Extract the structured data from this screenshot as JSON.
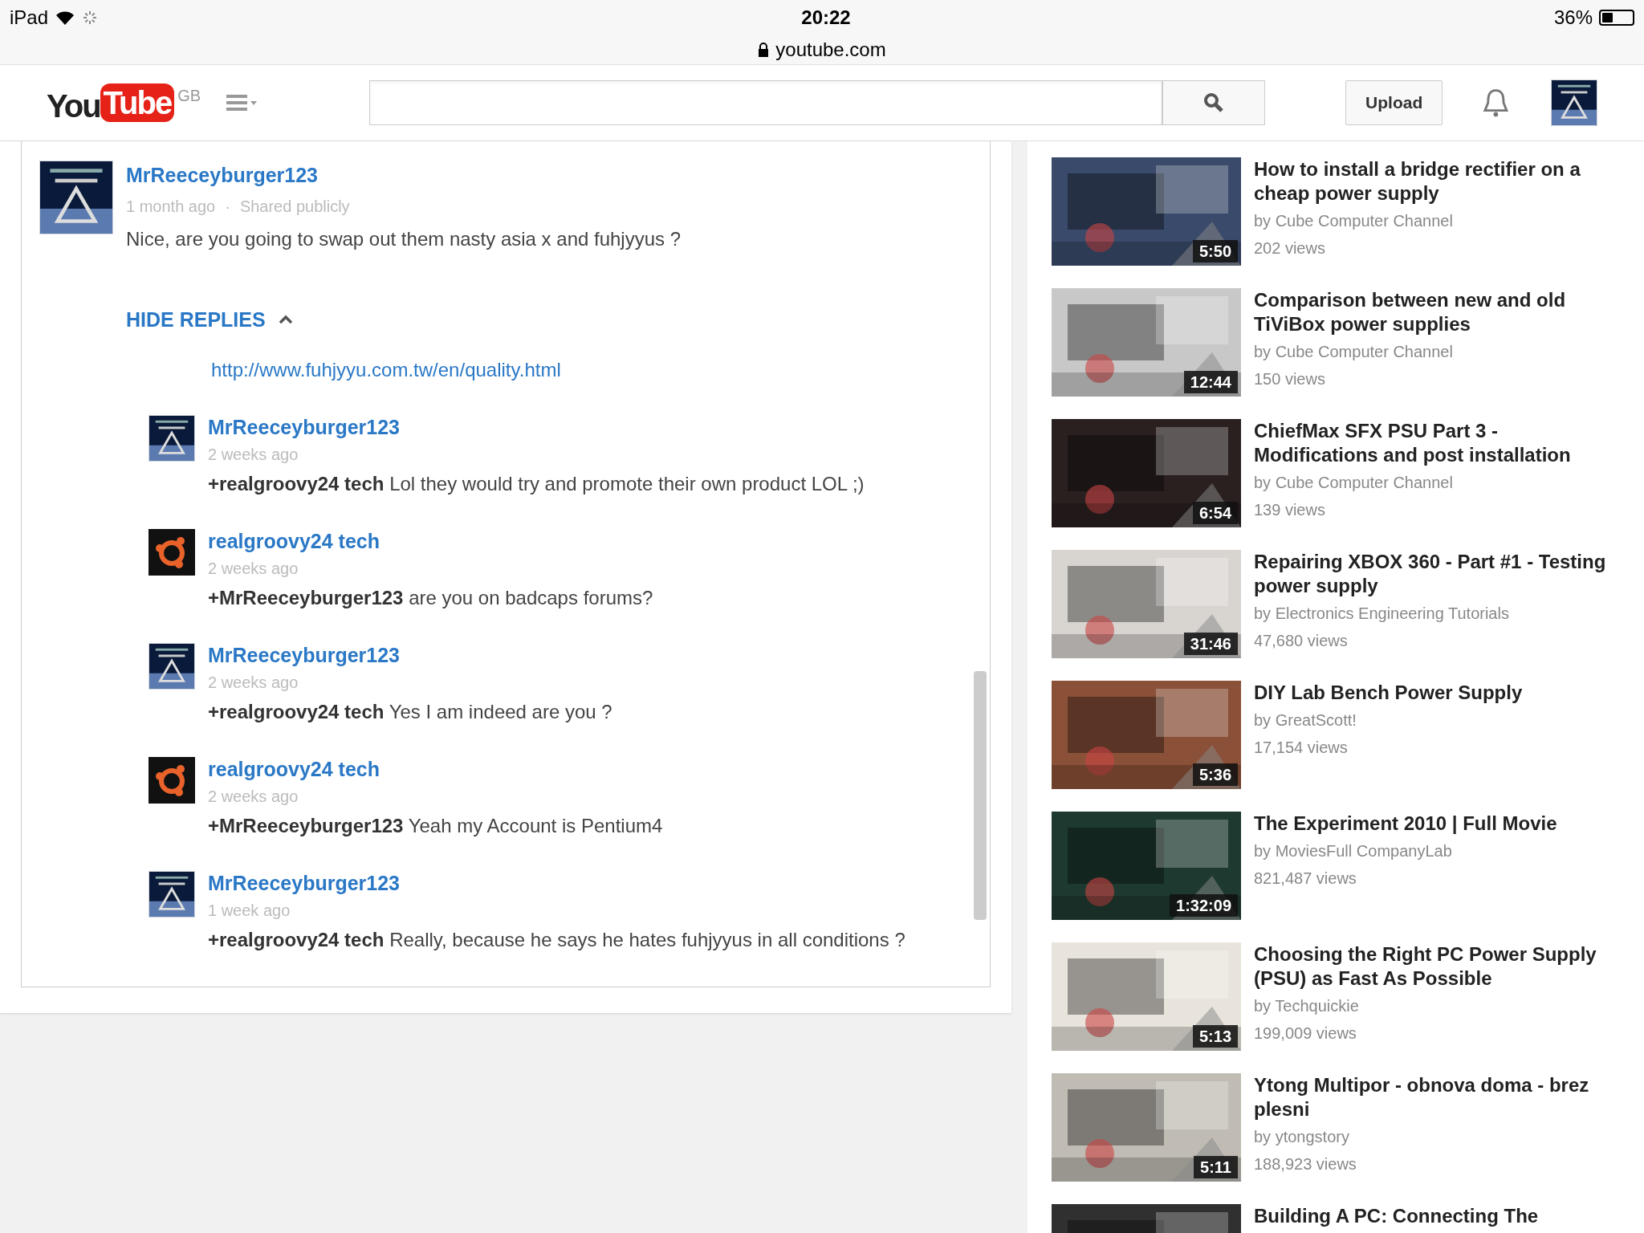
{
  "status_bar": {
    "device": "iPad",
    "time": "20:22",
    "url": "youtube.com",
    "battery_text": "36%",
    "battery": {
      "level": 0.36
    }
  },
  "header": {
    "logo_you": "You",
    "logo_tube": "Tube",
    "region": "GB",
    "upload": "Upload"
  },
  "comment": {
    "author": "MrReeceyburger123",
    "age": "1 month ago",
    "separator": "·",
    "visibility": "Shared publicly",
    "text": "Nice, are you going to swap out them nasty asia x and fuhjyyus ?",
    "hide_replies": "HIDE REPLIES",
    "link": "http://www.fuhjyyu.com.tw/en/quality.html",
    "replies": [
      {
        "author": "MrReeceyburger123",
        "kind": "speedmaster",
        "age": "2 weeks ago",
        "mention": "+realgroovy24 tech",
        "text": "Lol they would try and promote their own product LOL ;)"
      },
      {
        "author": "realgroovy24 tech",
        "kind": "orange",
        "age": "2 weeks ago",
        "mention": "+MrReeceyburger123",
        "text": "are you on badcaps forums?"
      },
      {
        "author": "MrReeceyburger123",
        "kind": "speedmaster",
        "age": "2 weeks ago",
        "mention": "+realgroovy24 tech",
        "text": "Yes I am indeed are you ?"
      },
      {
        "author": "realgroovy24 tech",
        "kind": "orange",
        "age": "2 weeks ago",
        "mention": "+MrReeceyburger123",
        "text": "Yeah my Account is Pentium4"
      },
      {
        "author": "MrReeceyburger123",
        "kind": "speedmaster",
        "age": "1 week ago",
        "mention": "+realgroovy24 tech",
        "text": "Really, because he says he hates fuhjyyus in all conditions ?"
      }
    ]
  },
  "related": [
    {
      "title": "How to install a bridge rectifier on a cheap power supply",
      "channel": "by Cube Computer Channel",
      "views": "202 views",
      "duration": "5:50"
    },
    {
      "title": "Comparison between new and old TiViBox power supplies",
      "channel": "by Cube Computer Channel",
      "views": "150 views",
      "duration": "12:44"
    },
    {
      "title": "ChiefMax SFX PSU Part 3 - Modifications and post installation",
      "channel": "by Cube Computer Channel",
      "views": "139 views",
      "duration": "6:54"
    },
    {
      "title": "Repairing XBOX 360 - Part #1 - Testing power supply",
      "channel": "by Electronics Engineering Tutorials",
      "views": "47,680 views",
      "duration": "31:46"
    },
    {
      "title": "DIY Lab Bench Power Supply",
      "channel": "by GreatScott!",
      "views": "17,154 views",
      "duration": "5:36"
    },
    {
      "title": "The Experiment 2010 | Full Movie",
      "channel": "by MoviesFull CompanyLab",
      "views": "821,487 views",
      "duration": "1:32:09"
    },
    {
      "title": "Choosing the Right PC Power Supply (PSU) as Fast As Possible",
      "channel": "by Techquickie",
      "views": "199,009 views",
      "duration": "5:13"
    },
    {
      "title": "Ytong Multipor - obnova doma - brez plesni",
      "channel": "by ytongstory",
      "views": "188,923 views",
      "duration": "5:11"
    },
    {
      "title": "Building A PC: Connecting The"
    }
  ]
}
